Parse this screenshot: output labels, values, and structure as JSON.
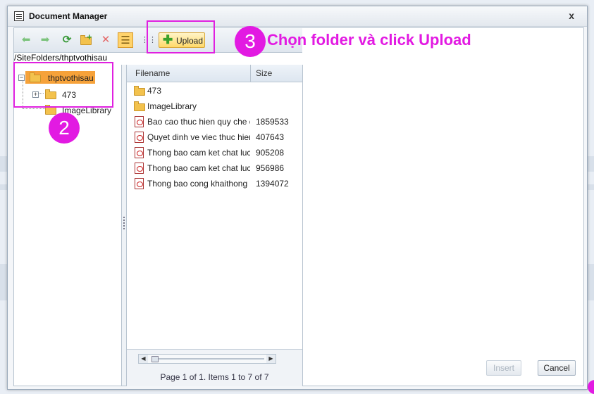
{
  "dialog": {
    "title": "Document Manager",
    "close_symbol": "x"
  },
  "toolbar": {
    "buttons": [
      {
        "name": "back-icon",
        "glyph": "⬅"
      },
      {
        "name": "forward-icon",
        "glyph": "➡"
      },
      {
        "name": "refresh-icon",
        "glyph": "⟳"
      },
      {
        "name": "new-folder-icon",
        "glyph": "+"
      },
      {
        "name": "delete-icon",
        "glyph": "✕"
      },
      {
        "name": "list-view-icon",
        "glyph": "☰"
      },
      {
        "name": "thumbnail-view-icon",
        "glyph": "⋮⋮"
      }
    ],
    "upload_label": "Upload"
  },
  "path": "/SiteFolders/thptvothisau",
  "tree": {
    "root": "thptvothisau",
    "children": [
      "473",
      "ImageLibrary"
    ]
  },
  "grid": {
    "columns": [
      "Filename",
      "Size"
    ],
    "rows": [
      {
        "type": "folder",
        "name": "473",
        "size": ""
      },
      {
        "type": "folder",
        "name": "ImageLibrary",
        "size": ""
      },
      {
        "type": "pdf",
        "name": "Bao cao thuc hien quy che c",
        "size": "1859533"
      },
      {
        "type": "pdf",
        "name": "Quyet dinh ve viec thuc hien",
        "size": "407643"
      },
      {
        "type": "pdf",
        "name": "Thong bao cam ket chat luc",
        "size": "905208"
      },
      {
        "type": "pdf",
        "name": "Thong bao cam ket chat luc",
        "size": "956986"
      },
      {
        "type": "pdf",
        "name": "Thong bao cong khaithong",
        "size": "1394072"
      }
    ],
    "pager_text": "Page 1 of 1. Items 1 to 7 of 7"
  },
  "annotations": {
    "step2": "2",
    "step3": "3",
    "step3_text": "Chọn folder và click Upload",
    "color": "#e21ae2"
  },
  "footer": {
    "insert_label": "Insert",
    "cancel_label": "Cancel"
  }
}
